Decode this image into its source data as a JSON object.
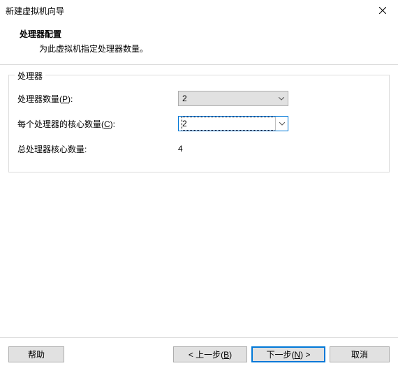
{
  "window": {
    "title": "新建虚拟机向导"
  },
  "header": {
    "title": "处理器配置",
    "subtitle": "为此虚拟机指定处理器数量。"
  },
  "group": {
    "legend": "处理器",
    "processors": {
      "label_pre": "处理器数量(",
      "hotkey": "P",
      "label_post": "):",
      "selected": "2"
    },
    "cores": {
      "label_pre": "每个处理器的核心数量(",
      "hotkey": "C",
      "label_post": "):",
      "selected": "2"
    },
    "total": {
      "label": "总处理器核心数量:",
      "value": "4"
    }
  },
  "buttons": {
    "help": "帮助",
    "back_pre": "< 上一步(",
    "back_hotkey": "B",
    "back_post": ")",
    "next_pre": "下一步(",
    "next_hotkey": "N",
    "next_post": ") >",
    "cancel": "取消"
  }
}
